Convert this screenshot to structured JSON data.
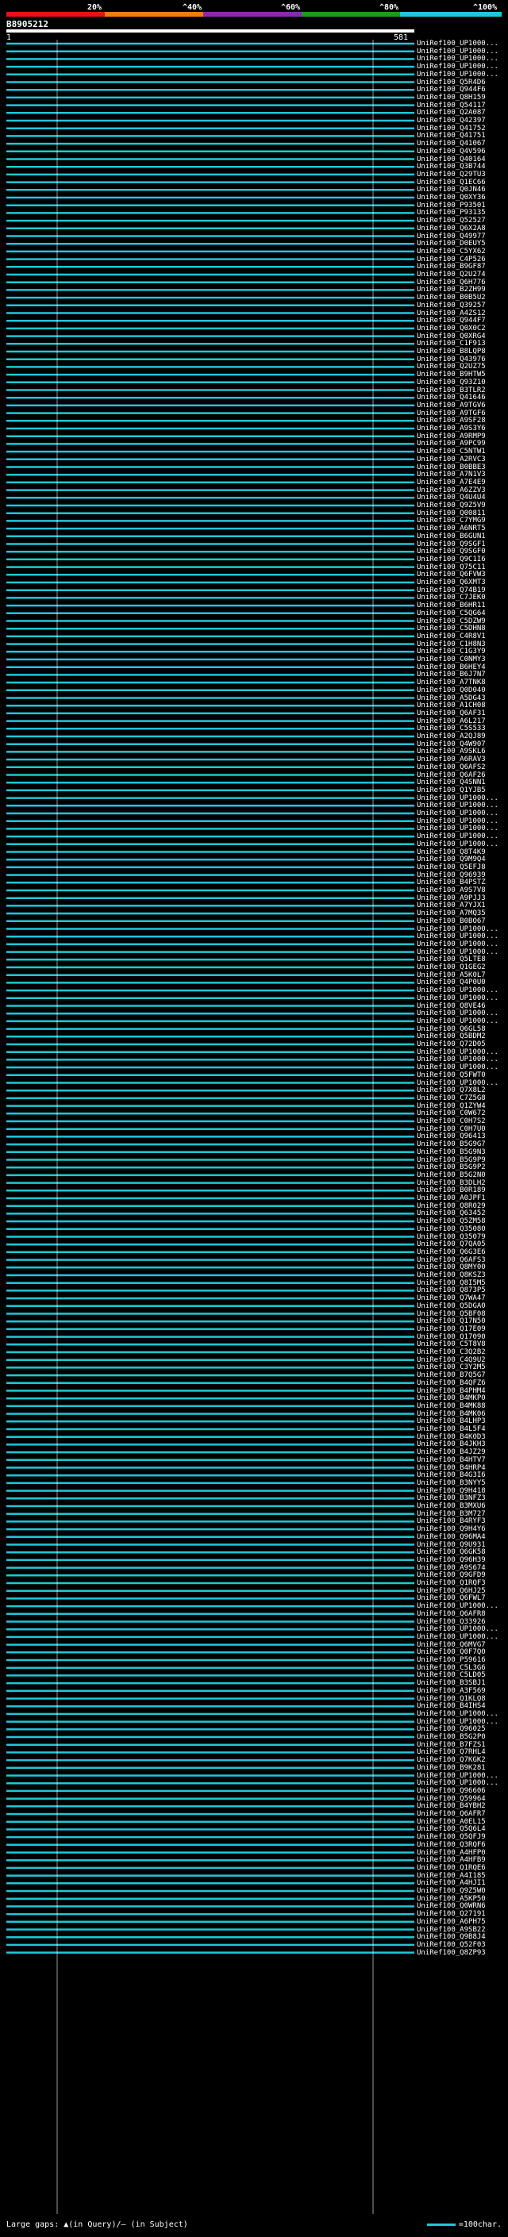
{
  "scale": {
    "ticks": [
      "20%",
      "^40%",
      "^60%",
      "^80%",
      "^100%"
    ],
    "colors": [
      "#e8101a",
      "#f07c12",
      "#8a2aa8",
      "#1e9a1e",
      "#1ec8d8"
    ]
  },
  "query": {
    "id": "B8905212",
    "start": "1",
    "end": "581"
  },
  "hits": [
    "UniRef100_UP1000...",
    "UniRef100_UP1000...",
    "UniRef100_UP1000...",
    "UniRef100_UP1000...",
    "UniRef100_UP1000...",
    "UniRef100_Q5R4D6",
    "UniRef100_Q944F6",
    "UniRef100_Q8H159",
    "UniRef100_Q54117",
    "UniRef100_Q2A087",
    "UniRef100_Q42397",
    "UniRef100_Q41752",
    "UniRef100_Q41751",
    "UniRef100_Q41067",
    "UniRef100_Q4V596",
    "UniRef100_Q40164",
    "UniRef100_Q3B744",
    "UniRef100_Q29TU3",
    "UniRef100_Q1EC66",
    "UniRef100_Q0JN46",
    "UniRef100_Q0XY36",
    "UniRef100_P93501",
    "UniRef100_P93135",
    "UniRef100_Q52527",
    "UniRef100_Q6X2A8",
    "UniRef100_Q49977",
    "UniRef100_D0EUY5",
    "UniRef100_C5YX62",
    "UniRef100_C4P526",
    "UniRef100_B9GF87",
    "UniRef100_Q2U274",
    "UniRef100_Q6H776",
    "UniRef100_B2ZH99",
    "UniRef100_B0B5U2",
    "UniRef100_Q39257",
    "UniRef100_A4ZS12",
    "UniRef100_Q944F7",
    "UniRef100_Q0X0C2",
    "UniRef100_Q0XRG4",
    "UniRef100_C1F913",
    "UniRef100_B8LQP8",
    "UniRef100_Q43976",
    "UniRef100_Q2UZ75",
    "UniRef100_B9HTW5",
    "UniRef100_Q93Z10",
    "UniRef100_B3TLR2",
    "UniRef100_Q41646",
    "UniRef100_A9TGV6",
    "UniRef100_A9TGF6",
    "UniRef100_A9SF28",
    "UniRef100_A9S3Y6",
    "UniRef100_A9RMP9",
    "UniRef100_A9PC99",
    "UniRef100_C5NTW1",
    "UniRef100_A2RVC3",
    "UniRef100_B0BBE3",
    "UniRef100_A7N1V3",
    "UniRef100_A7E4E9",
    "UniRef100_A6ZZV3",
    "UniRef100_Q4U4U4",
    "UniRef100_Q9Z5V9",
    "UniRef100_Q00811",
    "UniRef100_C7YMG9",
    "UniRef100_A6NRT5",
    "UniRef100_B6GUN1",
    "UniRef100_Q9SGF1",
    "UniRef100_Q9SGF0",
    "UniRef100_Q9C1I6",
    "UniRef100_Q75C11",
    "UniRef100_Q6FVW3",
    "UniRef100_Q6XMT3",
    "UniRef100_Q74B19",
    "UniRef100_C7JEK0",
    "UniRef100_B6HR11",
    "UniRef100_C5QG64",
    "UniRef100_C5DZW9",
    "UniRef100_C5DHN8",
    "UniRef100_C4R8V1",
    "UniRef100_C1H8N3",
    "UniRef100_C1G3Y9",
    "UniRef100_C0NMY3",
    "UniRef100_B6HEY4",
    "UniRef100_B6J7N7",
    "UniRef100_A7TNK8",
    "UniRef100_Q0D040",
    "UniRef100_A5DG43",
    "UniRef100_A1CH08",
    "UniRef100_Q6AF31",
    "UniRef100_A6L217",
    "UniRef100_C5S533",
    "UniRef100_A2QJ89",
    "UniRef100_Q4W907",
    "UniRef100_A9SKL6",
    "UniRef100_A6RAV3",
    "UniRef100_Q6AFS2",
    "UniRef100_Q6AF26",
    "UniRef100_Q4SNN1",
    "UniRef100_Q1YJB5",
    "UniRef100_UP1000...",
    "UniRef100_UP1000...",
    "UniRef100_UP1000...",
    "UniRef100_UP1000...",
    "UniRef100_UP1000...",
    "UniRef100_UP1000...",
    "UniRef100_UP1000...",
    "UniRef100_Q8T4K9",
    "UniRef100_Q9M9Q4",
    "UniRef100_Q5EFJ8",
    "UniRef100_Q96939",
    "UniRef100_B4PSTZ",
    "UniRef100_A9S7V8",
    "UniRef100_A9PJJ3",
    "UniRef100_A7YJX1",
    "UniRef100_A7MQ35",
    "UniRef100_B0BO67",
    "UniRef100_UP1000...",
    "UniRef100_UP1000...",
    "UniRef100_UP1000...",
    "UniRef100_UP1000...",
    "UniRef100_Q5LTE8",
    "UniRef100_Q1GEG2",
    "UniRef100_A5K0L7",
    "UniRef100_Q4P0U0",
    "UniRef100_UP1000...",
    "UniRef100_UP1000...",
    "UniRef100_Q8VE46",
    "UniRef100_UP1000...",
    "UniRef100_UP1000...",
    "UniRef100_Q6GL58",
    "UniRef100_Q5BDM2",
    "UniRef100_Q72D05",
    "UniRef100_UP1000...",
    "UniRef100_UP1000...",
    "UniRef100_UP1000...",
    "UniRef100_Q5FWT0",
    "UniRef100_UP1000...",
    "UniRef100_Q7X8L2",
    "UniRef100_C7Z5G8",
    "UniRef100_Q1ZYW4",
    "UniRef100_C0W672",
    "UniRef100_C0H7S2",
    "UniRef100_C0H7U0",
    "UniRef100_Q96413",
    "UniRef100_B5G9G7",
    "UniRef100_B5G9N3",
    "UniRef100_B5G9P9",
    "UniRef100_B5G9P2",
    "UniRef100_B5G2N0",
    "UniRef100_B3DLH2",
    "UniRef100_B0R189",
    "UniRef100_A0JPF1",
    "UniRef100_Q8R029",
    "UniRef100_Q63452",
    "UniRef100_Q5ZM58",
    "UniRef100_Q35080",
    "UniRef100_Q35079",
    "UniRef100_Q7QA05",
    "UniRef100_Q6G3E6",
    "UniRef100_Q6AFS3",
    "UniRef100_Q8MY00",
    "UniRef100_Q8KSZ3",
    "UniRef100_Q8I5M5",
    "UniRef100_Q873P5",
    "UniRef100_Q7WA47",
    "UniRef100_Q5DGA0",
    "UniRef100_Q5BF08",
    "UniRef100_Q17N50",
    "UniRef100_Q17E09",
    "UniRef100_Q17090",
    "UniRef100_C5T8V8",
    "UniRef100_C3Q2B2",
    "UniRef100_C4Q9U2",
    "UniRef100_C3Y2M5",
    "UniRef100_B7Q5G7",
    "UniRef100_B4QFZ6",
    "UniRef100_B4PHM4",
    "UniRef100_B4MKP0",
    "UniRef100_B4MK88",
    "UniRef100_B4MK06",
    "UniRef100_B4LHP3",
    "UniRef100_B4L5F4",
    "UniRef100_B4K0D3",
    "UniRef100_B4JKH3",
    "UniRef100_B4JZ29",
    "UniRef100_B4HTV7",
    "UniRef100_B4HRP4",
    "UniRef100_B4G3I6",
    "UniRef100_B3NYY5",
    "UniRef100_Q9H418",
    "UniRef100_B3NFZ3",
    "UniRef100_B3MXU6",
    "UniRef100_B3M727",
    "UniRef100_B4RYF3",
    "UniRef100_Q9H4Y6",
    "UniRef100_Q96MA4",
    "UniRef100_Q9U931",
    "UniRef100_Q6GK58",
    "UniRef100_Q96H39",
    "UniRef100_A9S674",
    "UniRef100_Q9GFD9",
    "UniRef100_Q1RQF3",
    "UniRef100_Q6HJ25",
    "UniRef100_Q6FWL7",
    "UniRef100_UP1000...",
    "UniRef100_Q6AFR8",
    "UniRef100_Q33926",
    "UniRef100_UP1000...",
    "UniRef100_UP1000...",
    "UniRef100_Q6MVG7",
    "UniRef100_Q0F7Q0",
    "UniRef100_P59616",
    "UniRef100_C5L3G6",
    "UniRef100_C5LD05",
    "UniRef100_B3SBJ1",
    "UniRef100_A3F569",
    "UniRef100_Q1KLQ8",
    "UniRef100_B4IHS4",
    "UniRef100_UP1000...",
    "UniRef100_UP1000...",
    "UniRef100_Q96025",
    "UniRef100_B5G2P0",
    "UniRef100_B7FZS1",
    "UniRef100_Q7RHL4",
    "UniRef100_Q7KGK2",
    "UniRef100_B9K281",
    "UniRef100_UP1000...",
    "UniRef100_UP1000...",
    "UniRef100_Q96606",
    "UniRef100_Q59964",
    "UniRef100_B4YBH2",
    "UniRef100_Q6AFR7",
    "UniRef100_A0EL15",
    "UniRef100_Q5Q6L4",
    "UniRef100_Q5QFJ9",
    "UniRef100_Q3RQF6",
    "UniRef100_A4HFP0",
    "UniRef100_A4HFB9",
    "UniRef100_Q1RQE6",
    "UniRef100_A4I185",
    "UniRef100_A4HJI1",
    "UniRef100_Q9Z5W0",
    "UniRef100_A5KP50",
    "UniRef100_Q0WRN6",
    "UniRef100_Q27191",
    "UniRef100_A6PH75",
    "UniRef100_A9SB22",
    "UniRef100_Q9B8J4",
    "UniRef100_Q52F03",
    "UniRef100_Q8ZP93"
  ],
  "footer": {
    "large_gaps": "Large gaps: ▲(in Query)/— (in Subject)",
    "legend": "=100char."
  }
}
